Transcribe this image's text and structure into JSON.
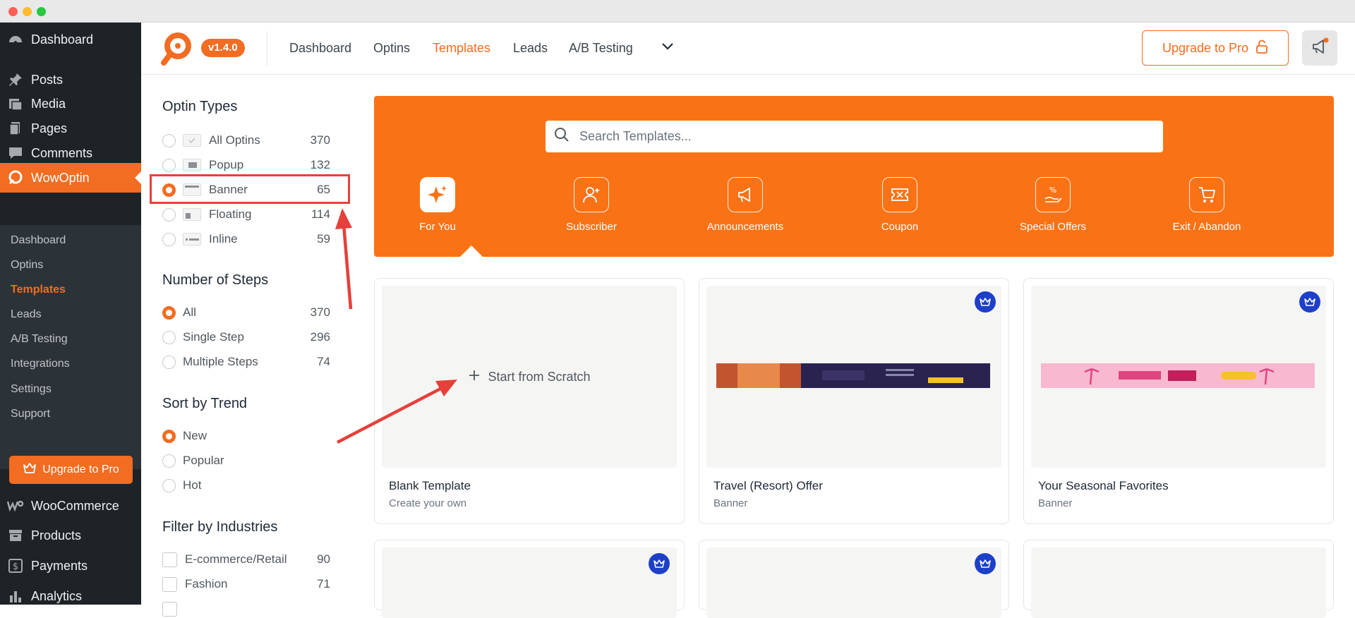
{
  "wp_menu": {
    "dashboard": "Dashboard",
    "posts": "Posts",
    "media": "Media",
    "pages": "Pages",
    "comments": "Comments",
    "wowoptin": "WowOptin",
    "woocommerce": "WooCommerce",
    "products": "Products",
    "payments": "Payments",
    "analytics": "Analytics"
  },
  "wow_submenu": {
    "dashboard": "Dashboard",
    "optins": "Optins",
    "templates": "Templates",
    "leads": "Leads",
    "ab_testing": "A/B Testing",
    "integrations": "Integrations",
    "settings": "Settings",
    "support": "Support",
    "upgrade": "Upgrade to Pro"
  },
  "header": {
    "version": "v1.4.0",
    "nav": [
      "Dashboard",
      "Optins",
      "Templates",
      "Leads",
      "A/B Testing"
    ],
    "upgrade_button": "Upgrade to Pro"
  },
  "filters": {
    "optin_types_title": "Optin Types",
    "optin_types": [
      {
        "label": "All Optins",
        "count": "370"
      },
      {
        "label": "Popup",
        "count": "132"
      },
      {
        "label": "Banner",
        "count": "65"
      },
      {
        "label": "Floating",
        "count": "114"
      },
      {
        "label": "Inline",
        "count": "59"
      }
    ],
    "steps_title": "Number of Steps",
    "steps": [
      {
        "label": "All",
        "count": "370"
      },
      {
        "label": "Single Step",
        "count": "296"
      },
      {
        "label": "Multiple Steps",
        "count": "74"
      }
    ],
    "trend_title": "Sort by Trend",
    "trend": [
      "New",
      "Popular",
      "Hot"
    ],
    "industries_title": "Filter by Industries",
    "industries": [
      {
        "label": "E-commerce/Retail",
        "count": "90"
      },
      {
        "label": "Fashion",
        "count": "71"
      }
    ]
  },
  "hero": {
    "search_placeholder": "Search Templates...",
    "categories": [
      "For You",
      "Subscriber",
      "Announcements",
      "Coupon",
      "Special Offers",
      "Exit / Abandon"
    ]
  },
  "cards": [
    {
      "title": "Blank Template",
      "subtitle": "Create your own",
      "action": "Start from Scratch"
    },
    {
      "title": "Travel (Resort) Offer",
      "subtitle": "Banner"
    },
    {
      "title": "Your Seasonal Favorites",
      "subtitle": "Banner"
    }
  ],
  "colors": {
    "accent": "#f26c22",
    "hero": "#f97316",
    "crown": "#1e3fc8",
    "annotation": "#e5403a"
  }
}
